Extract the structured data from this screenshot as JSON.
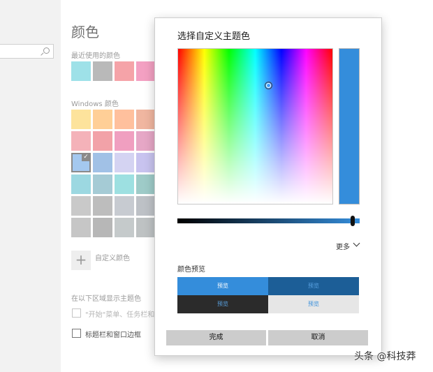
{
  "search": {
    "placeholder": ""
  },
  "settings": {
    "title": "颜色",
    "recent_label": "最近使用的颜色",
    "recent_colors": [
      "#9ee1e8",
      "#b9b9b9",
      "#f5a3a8",
      "#f3a0c2"
    ],
    "windows_label": "Windows 颜色",
    "windows_colors": [
      [
        "#fde39c",
        "#ffcf97",
        "#ffc09d",
        "#f0b6a0"
      ],
      [
        "#f4b2b9",
        "#f2a2a8",
        "#f09fc0",
        "#e6a7c6"
      ],
      [
        "#a4c8ef",
        "#a1c1e6",
        "#d4d3f2",
        "#c8c3ef"
      ],
      [
        "#9cd8e1",
        "#a5cbd5",
        "#9de0e1",
        "#9ecbc8"
      ],
      [
        "#c9c9c9",
        "#bdbdbd",
        "#c7cbd1",
        "#bdc1c6"
      ],
      [
        "#c6c6c6",
        "#b7b7b7",
        "#c5cacb",
        "#bec2c3"
      ]
    ],
    "selected_color": "#a4c8ef",
    "custom_label": "自定义颜色",
    "custom_plus": "+",
    "show_accent_label": "在以下区域显示主题色",
    "opt_start_label": "\"开始\"菜单、任务栏和操",
    "opt_title_label": "标题栏和窗口边框",
    "check_glyph": "✓"
  },
  "dialog": {
    "title": "选择自定义主题色",
    "current_color": "#348ddb",
    "hue_sat_cursor": {
      "hue_deg": 211,
      "saturation": 0.76
    },
    "brightness": 0.96,
    "more_label": "更多",
    "preview_heading": "颜色预览",
    "previews": [
      {
        "label": "预览",
        "bg": "#348ddb",
        "fg": "#ffffff"
      },
      {
        "label": "预览",
        "bg": "#1c5e97",
        "fg": "#5aa3e3"
      },
      {
        "label": "预览",
        "bg": "#2b2b2b",
        "fg": "#5aa3e3"
      },
      {
        "label": "预览",
        "bg": "#e6e6e6",
        "fg": "#348ddb"
      }
    ],
    "done_label": "完成",
    "cancel_label": "取消"
  },
  "watermark": "头条 @科技莽"
}
